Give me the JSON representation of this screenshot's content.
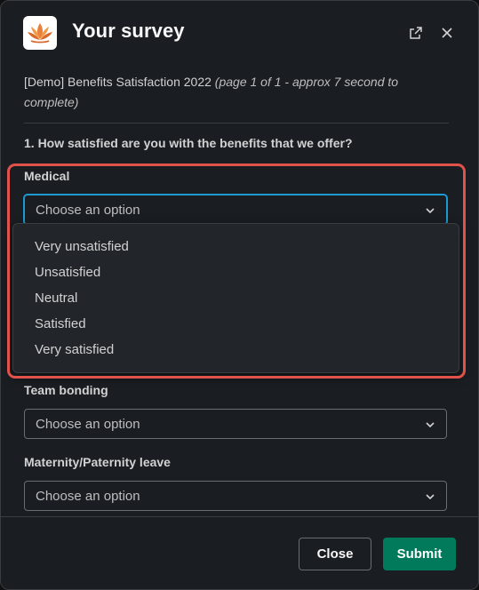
{
  "modal": {
    "title": "Your survey",
    "logo_icon": "lotus-logo-icon",
    "open_external_icon": "external-link-icon",
    "close_icon": "close-icon"
  },
  "survey": {
    "name": "[Demo] Benefits Satisfaction 2022",
    "meta": "(page 1 of 1 - approx 7 second to complete)"
  },
  "question": {
    "text": "1. How satisfied are you with the benefits that we offer?"
  },
  "fields": [
    {
      "label": "Medical",
      "value": "Choose an option",
      "state": "open"
    },
    {
      "label": "Team bonding",
      "value": "Choose an option"
    },
    {
      "label": "Maternity/Paternity leave",
      "value": "Choose an option"
    }
  ],
  "dropdown": {
    "options": [
      "Very unsatisfied",
      "Unsatisfied",
      "Neutral",
      "Satisfied",
      "Very satisfied"
    ]
  },
  "footer": {
    "close_label": "Close",
    "submit_label": "Submit"
  },
  "colors": {
    "background": "#1a1d21",
    "submit": "#007a5a",
    "focus": "#1d9bd1",
    "highlight": "#e0524a",
    "logo_orange": "#e8813a"
  }
}
